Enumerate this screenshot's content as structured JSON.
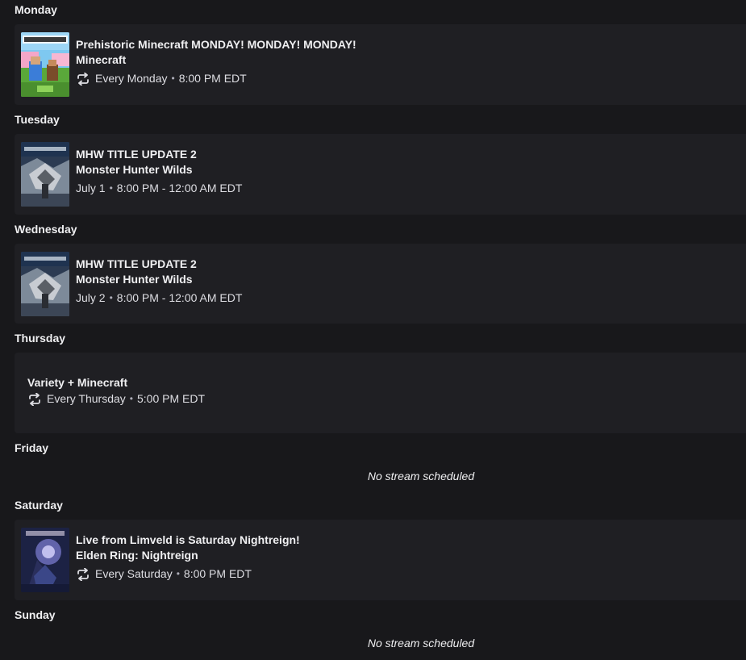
{
  "days": [
    {
      "label": "Monday",
      "title": "Prehistoric Minecraft MONDAY! MONDAY! MONDAY!",
      "game": "Minecraft",
      "when": "Every Monday",
      "time": "8:00 PM EDT",
      "repeat": true,
      "thumbnail": "minecraft-cover-icon"
    },
    {
      "label": "Tuesday",
      "title": "MHW TITLE UPDATE 2",
      "game": "Monster Hunter Wilds",
      "when": "July 1",
      "time": "8:00 PM - 12:00 AM EDT",
      "repeat": false,
      "thumbnail": "monster-hunter-wilds-cover-icon"
    },
    {
      "label": "Wednesday",
      "title": "MHW TITLE UPDATE 2",
      "game": "Monster Hunter Wilds",
      "when": "July 2",
      "time": "8:00 PM - 12:00 AM EDT",
      "repeat": false,
      "thumbnail": "monster-hunter-wilds-cover-icon"
    },
    {
      "label": "Thursday",
      "title": "Variety + Minecraft",
      "when": "Every Thursday",
      "time": "5:00 PM EDT",
      "repeat": true
    },
    {
      "label": "Friday",
      "empty_text": "No stream scheduled"
    },
    {
      "label": "Saturday",
      "title": "Live from Limveld is Saturday Nightreign!",
      "game": "Elden Ring: Nightreign",
      "when": "Every Saturday",
      "time": "8:00 PM EDT",
      "repeat": true,
      "thumbnail": "elden-ring-nightreign-cover-icon"
    },
    {
      "label": "Sunday",
      "empty_text": "No stream scheduled"
    }
  ],
  "colors": {
    "background": "#18181b",
    "card": "#1f1f23",
    "text": "#efeff1",
    "muted": "#adadb8"
  },
  "icons": {
    "repeat": "repeat-icon"
  }
}
